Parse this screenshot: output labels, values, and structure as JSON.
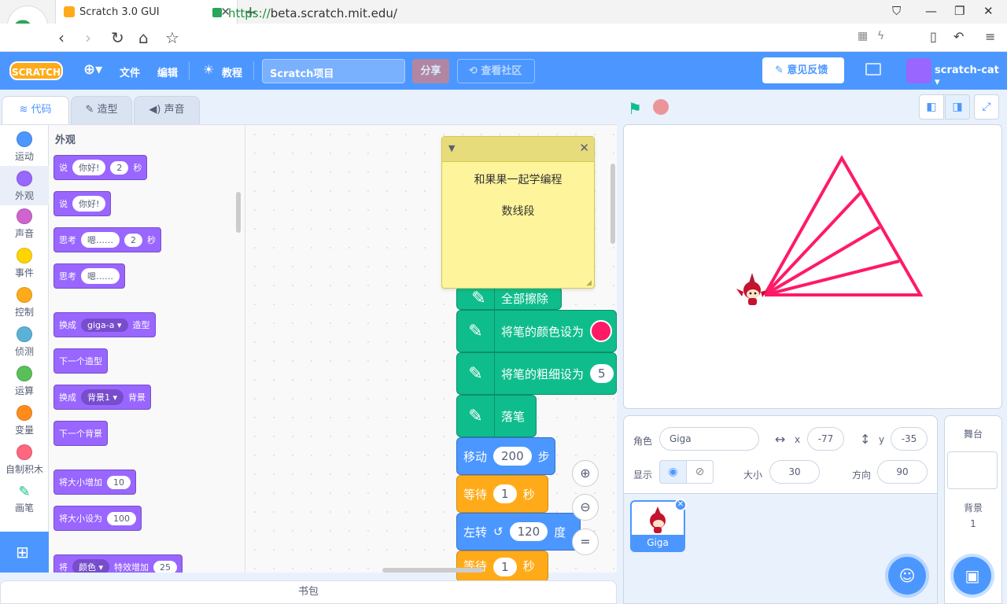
{
  "browser": {
    "tab_title": "Scratch 3.0 GUI",
    "url_scheme": "https://",
    "url_host": "beta.scratch.mit.edu/"
  },
  "menu": {
    "logo": "SCRATCH",
    "file": "文件",
    "edit": "编辑",
    "tutorials": "教程",
    "project_title": "Scratch项目",
    "share": "分享",
    "community": "查看社区",
    "feedback": "意见反馈",
    "username": "scratch-cat"
  },
  "tabs": {
    "code": "代码",
    "costumes": "造型",
    "sounds": "声音"
  },
  "categories": [
    {
      "label": "运动",
      "color": "#4c97ff"
    },
    {
      "label": "外观",
      "color": "#9966ff"
    },
    {
      "label": "声音",
      "color": "#cf63cf"
    },
    {
      "label": "事件",
      "color": "#ffd500"
    },
    {
      "label": "控制",
      "color": "#ffab19"
    },
    {
      "label": "侦测",
      "color": "#5cb1d6"
    },
    {
      "label": "运算",
      "color": "#59c059"
    },
    {
      "label": "变量",
      "color": "#ff8c1a"
    },
    {
      "label": "自制积木",
      "color": "#ff6680"
    },
    {
      "label": "画笔",
      "color": "#0fbd8c"
    }
  ],
  "palette": {
    "title": "外观",
    "blocks": [
      {
        "parts": [
          {
            "t": "说"
          },
          {
            "i": "你好!"
          },
          {
            "i": "2"
          },
          {
            "t": "秒"
          }
        ]
      },
      {
        "parts": [
          {
            "t": "说"
          },
          {
            "i": "你好!"
          }
        ]
      },
      {
        "parts": [
          {
            "t": "思考"
          },
          {
            "i": "嗯……"
          },
          {
            "i": "2"
          },
          {
            "t": "秒"
          }
        ]
      },
      {
        "parts": [
          {
            "t": "思考"
          },
          {
            "i": "嗯……"
          }
        ]
      },
      {
        "parts": [
          {
            "t": "换成"
          },
          {
            "d": "giga-a ▾"
          },
          {
            "t": "造型"
          }
        ]
      },
      {
        "parts": [
          {
            "t": "下一个造型"
          }
        ]
      },
      {
        "parts": [
          {
            "t": "换成"
          },
          {
            "d": "背景1 ▾"
          },
          {
            "t": "背景"
          }
        ]
      },
      {
        "parts": [
          {
            "t": "下一个背景"
          }
        ]
      },
      {
        "parts": [
          {
            "t": "将大小增加"
          },
          {
            "i": "10"
          }
        ]
      },
      {
        "parts": [
          {
            "t": "将大小设为"
          },
          {
            "i": "100"
          }
        ]
      },
      {
        "parts": [
          {
            "t": "将"
          },
          {
            "d": "颜色 ▾"
          },
          {
            "t": "特效增加"
          },
          {
            "i": "25"
          }
        ]
      }
    ]
  },
  "note": {
    "line1": "和果果一起学编程",
    "line2": "数线段"
  },
  "script": {
    "clear_partial": "全部擦除",
    "pen_color": "将笔的颜色设为",
    "pen_color_value": "#ff1a66",
    "pen_size": "将笔的粗细设为",
    "pen_size_value": "5",
    "pen_down": "落笔",
    "move": "移动",
    "move_value": "200",
    "steps": "步",
    "wait": "等待",
    "wait_value": "1",
    "seconds": "秒",
    "turn_left": "左转",
    "turn_value": "120",
    "degrees": "度",
    "wait2": "等待",
    "wait2_value": "1",
    "seconds2": "秒"
  },
  "backpack": "书包",
  "sprite_info": {
    "sprite_label": "角色",
    "sprite_name": "Giga",
    "x_label": "x",
    "x_value": "-77",
    "y_label": "y",
    "y_value": "-35",
    "show_label": "显示",
    "size_label": "大小",
    "size_value": "30",
    "direction_label": "方向",
    "direction_value": "90"
  },
  "sprite_list": [
    {
      "name": "Giga"
    }
  ],
  "stage_panel": {
    "title": "舞台",
    "backdrops_label": "背景",
    "backdrops_count": "1"
  }
}
